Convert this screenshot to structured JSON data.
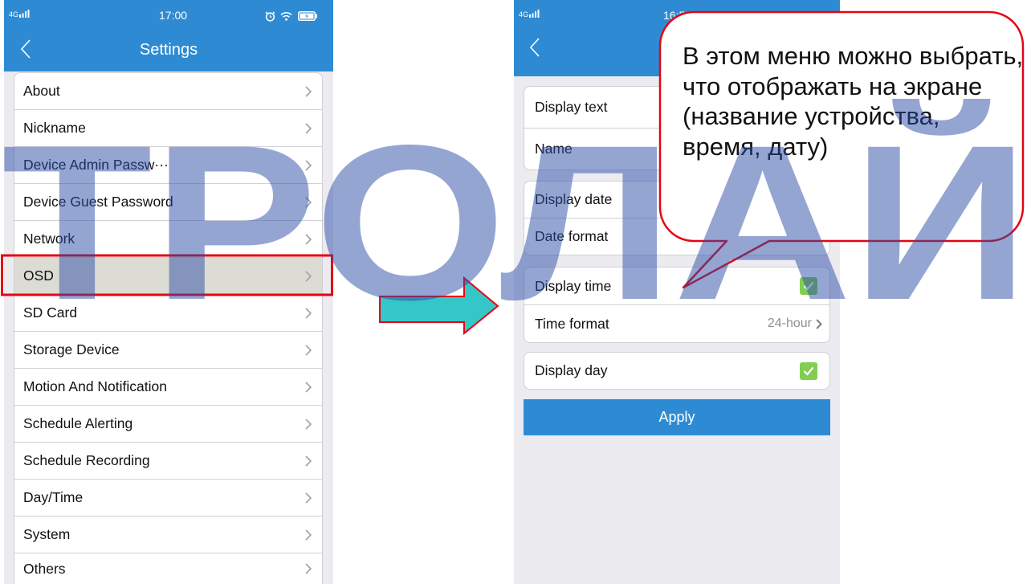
{
  "left_phone": {
    "status_bar": {
      "network": "4G",
      "time": "17:00"
    },
    "nav": {
      "title": "Settings"
    },
    "menu": [
      {
        "label": "About"
      },
      {
        "label": "Nickname"
      },
      {
        "label": "Device Admin Passw···"
      },
      {
        "label": "Device Guest Password"
      },
      {
        "label": "Network"
      },
      {
        "label": "OSD",
        "selected": true
      },
      {
        "label": "SD Card"
      },
      {
        "label": "Storage Device"
      },
      {
        "label": "Motion And Notification"
      },
      {
        "label": "Schedule Alerting"
      },
      {
        "label": "Schedule Recording"
      },
      {
        "label": "Day/Time"
      },
      {
        "label": "System"
      },
      {
        "label": "Others"
      }
    ]
  },
  "right_phone": {
    "status_bar": {
      "network": "4G",
      "time": "16:5"
    },
    "groups": [
      {
        "rows": [
          {
            "label": "Display text"
          },
          {
            "label": "Name"
          }
        ]
      },
      {
        "rows": [
          {
            "label": "Display date"
          },
          {
            "label": "Date format"
          }
        ]
      },
      {
        "rows": [
          {
            "label": "Display time",
            "checked": true
          },
          {
            "label": "Time format",
            "value": "24-hour"
          }
        ]
      },
      {
        "rows": [
          {
            "label": "Display day",
            "checked": true
          }
        ]
      }
    ],
    "apply_label": "Apply"
  },
  "callout": {
    "lines": [
      "В этом меню можно выбрать,",
      "что отображать на экране",
      "(название устройства,",
      "время, дату)"
    ]
  },
  "watermark": "ТРОЛАЙ",
  "icons": {
    "back": "chevron-left-icon",
    "row": "chevron-right-icon",
    "checkbox": "checkmark-icon",
    "status": [
      "signal-icon",
      "alarm-icon",
      "wifi-icon",
      "battery-icon"
    ],
    "pointer": "arrow-right-icon"
  },
  "colors": {
    "accent": "#2e8bd3",
    "mark": "#e30613",
    "arrow": "#35c7c8",
    "check": "#82cd52",
    "watermark": "#2c4ca6"
  }
}
